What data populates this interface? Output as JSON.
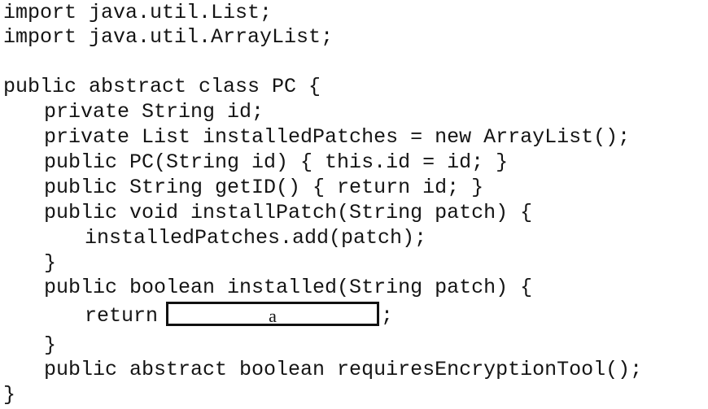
{
  "code_lines": [
    "import java.util.List;",
    "import java.util.ArrayList;",
    "",
    "public abstract class PC {",
    "private String id;",
    "private List installedPatches = new ArrayList();",
    "public PC(String id) { this.id = id; }",
    "public String getID() { return id; }",
    "public void installPatch(String patch) {",
    "installedPatches.add(patch);",
    "}",
    "public boolean installed(String patch) {",
    "return",
    "a",
    ";",
    "}",
    "public abstract boolean requiresEncryptionTool();",
    "}"
  ]
}
